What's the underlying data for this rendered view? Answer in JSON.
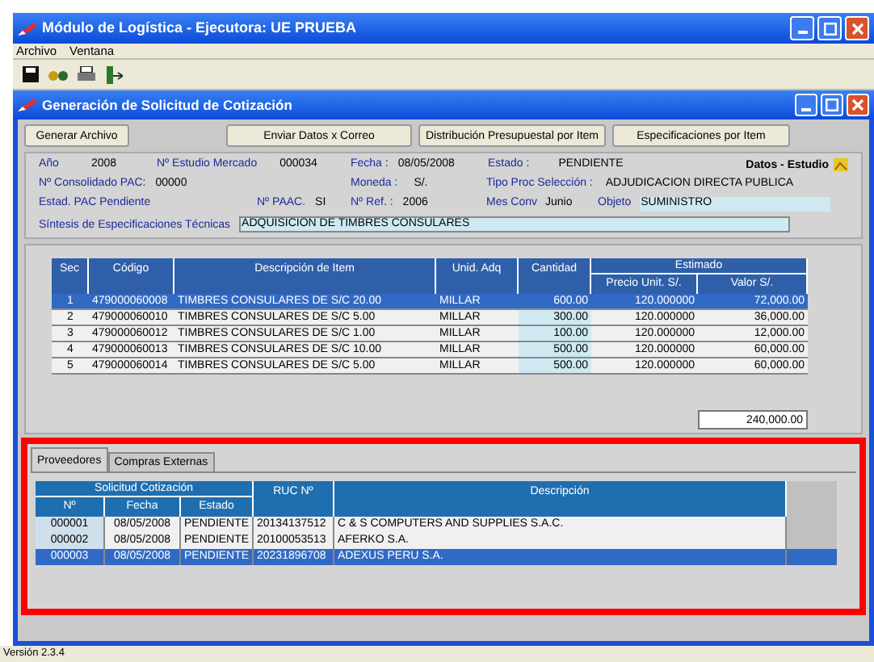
{
  "window": {
    "title": "Módulo de Logística - Ejecutora: UE PRUEBA"
  },
  "menu": [
    "Archivo",
    "Ventana"
  ],
  "inner_window": {
    "title": "Generación de Solicitud de Cotización"
  },
  "buttons": [
    "Generar Archivo",
    "Enviar Datos x Correo",
    "Distribución Presupuestal por Item",
    "Especificaciones por Item"
  ],
  "header": {
    "fields": [
      {
        "label": "Año",
        "value": "2008",
        "kind": "text"
      },
      {
        "label": "Nº Estudio Mercado",
        "value": "000034",
        "kind": "text"
      },
      {
        "label": "Fecha :",
        "value": "08/05/2008",
        "kind": "text"
      },
      {
        "label": "Estado :",
        "value": "PENDIENTE",
        "kind": "text"
      },
      {
        "label": "Nº Consolidado PAC:",
        "value": "00000",
        "kind": "text"
      },
      {
        "label": "Moneda :",
        "value": "S/.",
        "kind": "text"
      },
      {
        "label": "Tipo Proc Selección :",
        "value": "ADJUDICACION DIRECTA PUBLICA",
        "kind": "text"
      },
      {
        "label": "Estad. PAC Pendiente",
        "kind": "text"
      },
      {
        "label": "Nº PAAC.",
        "value": "SI",
        "kind": "text"
      },
      {
        "label": "Nº Ref. :",
        "value": "2006",
        "kind": "text"
      },
      {
        "label": "Mes Conv",
        "value": "Junio",
        "kind": "text"
      },
      {
        "label": "Objeto",
        "value": "SUMINISTRO",
        "kind": "input"
      }
    ],
    "datos_link": "Datos - Estudio",
    "sintesis": {
      "label": "Síntesis de Especificaciones Técnicas",
      "value": "ADQUISICION DE TIMBRES CONSULARES"
    }
  },
  "items": {
    "columns": [
      "Sec",
      "Código",
      "Descripción de Item",
      "Unid. Adq",
      "Cantidad",
      "Precio Unit. S/.",
      "Valor S/."
    ],
    "column_groups": [
      "Estimado"
    ],
    "rows": [
      {
        "cells": [
          "1",
          "479000060008",
          "TIMBRES CONSULARES DE S/C 20.00",
          "MILLAR",
          "600.00",
          "120.000000",
          "72,000.00"
        ],
        "selected": true
      },
      {
        "cells": [
          "2",
          "479000060010",
          "TIMBRES CONSULARES DE S/C 5.00",
          "MILLAR",
          "300.00",
          "120.000000",
          "36,000.00"
        ],
        "selected": false
      },
      {
        "cells": [
          "3",
          "479000060012",
          "TIMBRES CONSULARES DE S/C 1.00",
          "MILLAR",
          "100.00",
          "120.000000",
          "12,000.00"
        ],
        "selected": false
      },
      {
        "cells": [
          "4",
          "479000060013",
          "TIMBRES CONSULARES DE S/C 10.00",
          "MILLAR",
          "500.00",
          "120.000000",
          "60,000.00"
        ],
        "selected": false
      },
      {
        "cells": [
          "5",
          "479000060014",
          "TIMBRES CONSULARES DE S/C 5.00",
          "MILLAR",
          "500.00",
          "120.000000",
          "60,000.00"
        ],
        "selected": false
      }
    ],
    "total": "240,000.00"
  },
  "tabs": [
    {
      "label": "Proveedores",
      "selected": true
    },
    {
      "label": "Compras Externas",
      "selected": false
    }
  ],
  "providers": {
    "columns": [
      "Nº",
      "Fecha",
      "Estado",
      "RUC Nº",
      "Descripción"
    ],
    "column_groups": [
      "Solicitud Cotización"
    ],
    "rows": [
      {
        "cells": [
          "000001",
          "08/05/2008",
          "PENDIENTE",
          "20134137512",
          "C & S COMPUTERS AND SUPPLIES S.A.C."
        ],
        "selected": false
      },
      {
        "cells": [
          "000002",
          "08/05/2008",
          "PENDIENTE",
          "20100053513",
          "AFERKO S.A."
        ],
        "selected": false
      },
      {
        "cells": [
          "000003",
          "08/05/2008",
          "PENDIENTE",
          "20231896708",
          "ADEXUS PERU S.A."
        ],
        "selected": true
      }
    ]
  },
  "status_bar": "Versión 2.3.4"
}
